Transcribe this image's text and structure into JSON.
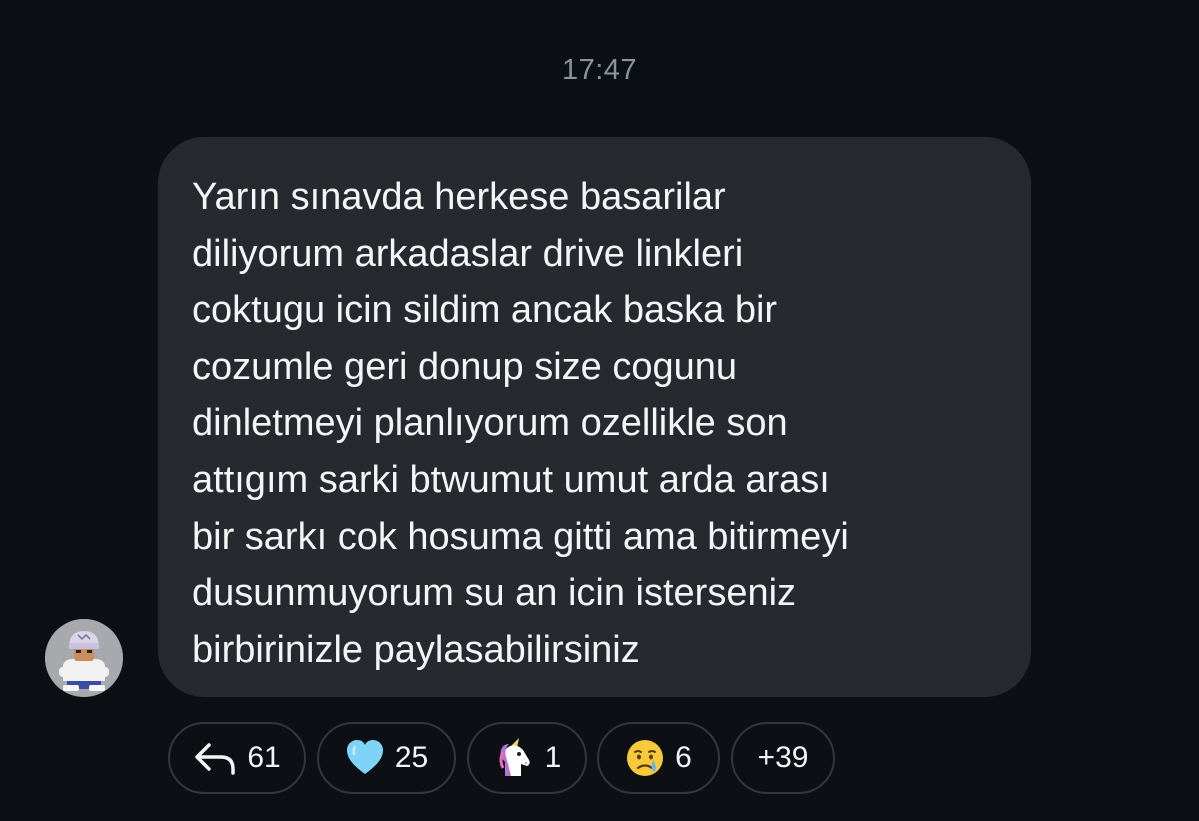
{
  "message": {
    "time": "17:47",
    "text": "Yarın sınavda herkese basarilar\ndiliyorum arkadaslar drive linkleri\ncoktugu icin sildim ancak baska bir\ncozumle geri donup size cogunu\ndinletmeyi planlıyorum ozellikle son\nattıgım sarki btwumut umut arda arası\nbir sarkı cok hosuma gitti ama bitirmeyi\ndusunmuyorum su an icin isterseniz\nbirbirinizle paylasabilirsiniz",
    "sender_avatar_icon": "user-avatar"
  },
  "reactions": [
    {
      "icon": "reply-arrow-icon",
      "count": "61"
    },
    {
      "icon": "blue-heart-icon",
      "count": "25"
    },
    {
      "icon": "unicorn-icon",
      "count": "1"
    },
    {
      "icon": "crying-face-icon",
      "count": "6"
    },
    {
      "icon": "more-reactions",
      "count": "+39"
    }
  ],
  "colors": {
    "background": "#0c0f13",
    "bubble": "#262a2f",
    "text": "#f4f5f6",
    "muted": "#8b939c",
    "pill_border": "#32373d"
  }
}
